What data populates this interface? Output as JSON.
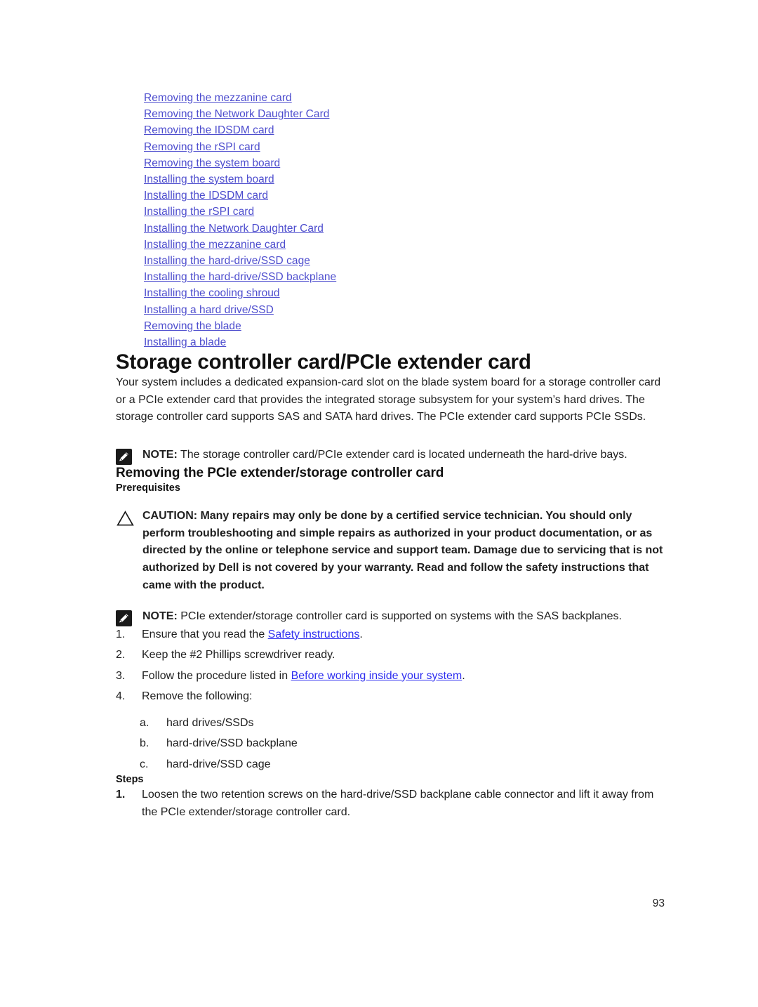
{
  "related_links": [
    "Removing the mezzanine card",
    "Removing the Network Daughter Card",
    "Removing the IDSDM card",
    "Removing the rSPI card",
    "Removing the system board",
    "Installing the system board",
    "Installing the IDSDM card",
    "Installing the rSPI card",
    "Installing the Network Daughter Card",
    "Installing the mezzanine card",
    "Installing the hard-drive/SSD cage",
    "Installing the hard-drive/SSD backplane",
    "Installing the cooling shroud",
    "Installing a hard drive/SSD",
    "Removing the blade",
    "Installing a blade"
  ],
  "section": {
    "title": "Storage controller card/PCIe extender card",
    "intro": "Your system includes a dedicated expansion-card slot on the blade system board for a storage controller card or a PCIe extender card that provides the integrated storage subsystem for your system’s hard drives. The storage controller card supports SAS and SATA hard drives. The PCIe extender card supports PCIe SSDs.",
    "note1": {
      "label": "NOTE:",
      "text": " The storage controller card/PCIe extender card is located underneath the hard-drive bays.",
      "icon": "note-pencil-icon"
    },
    "subtitle": "Removing the PCIe extender/storage controller card",
    "prerequisites_heading": "Prerequisites",
    "caution": {
      "label": "CAUTION:",
      "text": " Many repairs may only be done by a certified service technician. You should only perform troubleshooting and simple repairs as authorized in your product documentation, or as directed by the online or telephone service and support team. Damage due to servicing that is not authorized by Dell is not covered by your warranty. Read and follow the safety instructions that came with the product.",
      "icon": "caution-triangle-icon"
    },
    "note2": {
      "label": "NOTE:",
      "text": " PCIe extender/storage controller card is supported on systems with the SAS backplanes.",
      "icon": "note-pencil-icon"
    },
    "prerequisite_steps": [
      {
        "marker": "1.",
        "pre": "Ensure that you read the ",
        "link": "Safety instructions",
        "post": "."
      },
      {
        "marker": "2.",
        "pre": "Keep the #2 Phillips screwdriver ready.",
        "link": "",
        "post": ""
      },
      {
        "marker": "3.",
        "pre": "Follow the procedure listed in ",
        "link": "Before working inside your system",
        "post": "."
      },
      {
        "marker": "4.",
        "pre": "Remove the following:",
        "link": "",
        "post": ""
      }
    ],
    "remove_sublist": [
      {
        "marker": "a.",
        "text": "hard drives/SSDs"
      },
      {
        "marker": "b.",
        "text": "hard-drive/SSD backplane"
      },
      {
        "marker": "c.",
        "text": "hard-drive/SSD cage"
      }
    ],
    "steps_heading": "Steps",
    "steps": [
      {
        "marker": "1.",
        "text": "Loosen the two retention screws on the hard-drive/SSD backplane cable connector and lift it away from the PCIe extender/storage controller card."
      }
    ]
  },
  "page_number": "93",
  "colors": {
    "related_link": "#4d4dce",
    "inline_link": "#2f2ff0",
    "text": "#1f1f1f",
    "heading": "#111111"
  }
}
